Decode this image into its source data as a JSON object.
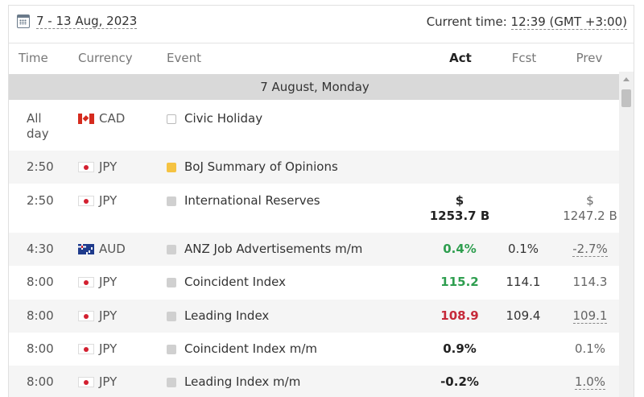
{
  "topbar": {
    "date_range": "7 - 13 Aug, 2023",
    "current_time_label": "Current time:",
    "current_time_value": "12:39 (GMT +3:00)"
  },
  "columns": {
    "time": "Time",
    "currency": "Currency",
    "event": "Event",
    "act": "Act",
    "fcst": "Fcst",
    "prev": "Prev"
  },
  "day_header": "7 August, Monday",
  "rows": [
    {
      "time": "All day",
      "flag": "ca",
      "currency": "CAD",
      "importance": "none",
      "event": "Civic Holiday",
      "act": "",
      "fcst": "",
      "prev": ""
    },
    {
      "time": "2:50",
      "flag": "jp",
      "currency": "JPY",
      "importance": "medium",
      "event": "BoJ Summary of Opinions",
      "act": "",
      "fcst": "",
      "prev": ""
    },
    {
      "time": "2:50",
      "flag": "jp",
      "currency": "JPY",
      "importance": "low",
      "event": "International Reserves",
      "act_line1": "$",
      "act_line2": "1253.7 B",
      "fcst": "",
      "prev_line1": "$",
      "prev_line2": "1247.2 B"
    },
    {
      "time": "4:30",
      "flag": "au",
      "currency": "AUD",
      "importance": "low",
      "event": "ANZ Job Advertisements m/m",
      "act": "0.4%",
      "act_color": "green",
      "fcst": "0.1%",
      "prev": "-2.7%",
      "prev_revised": true
    },
    {
      "time": "8:00",
      "flag": "jp",
      "currency": "JPY",
      "importance": "low",
      "event": "Coincident Index",
      "act": "115.2",
      "act_color": "green",
      "fcst": "114.1",
      "prev": "114.3"
    },
    {
      "time": "8:00",
      "flag": "jp",
      "currency": "JPY",
      "importance": "low",
      "event": "Leading Index",
      "act": "108.9",
      "act_color": "red",
      "fcst": "109.4",
      "prev": "109.1",
      "prev_revised": true
    },
    {
      "time": "8:00",
      "flag": "jp",
      "currency": "JPY",
      "importance": "low",
      "event": "Coincident Index m/m",
      "act": "0.9%",
      "fcst": "",
      "prev": "0.1%"
    },
    {
      "time": "8:00",
      "flag": "jp",
      "currency": "JPY",
      "importance": "low",
      "event": "Leading Index m/m",
      "act": "-0.2%",
      "fcst": "",
      "prev": "1.0%",
      "prev_revised": true
    }
  ],
  "colors": {
    "positive": "#2e9e4f",
    "negative": "#c62a3a",
    "medium_importance": "#f5c342",
    "day_header_bg": "#d9d9d9"
  }
}
